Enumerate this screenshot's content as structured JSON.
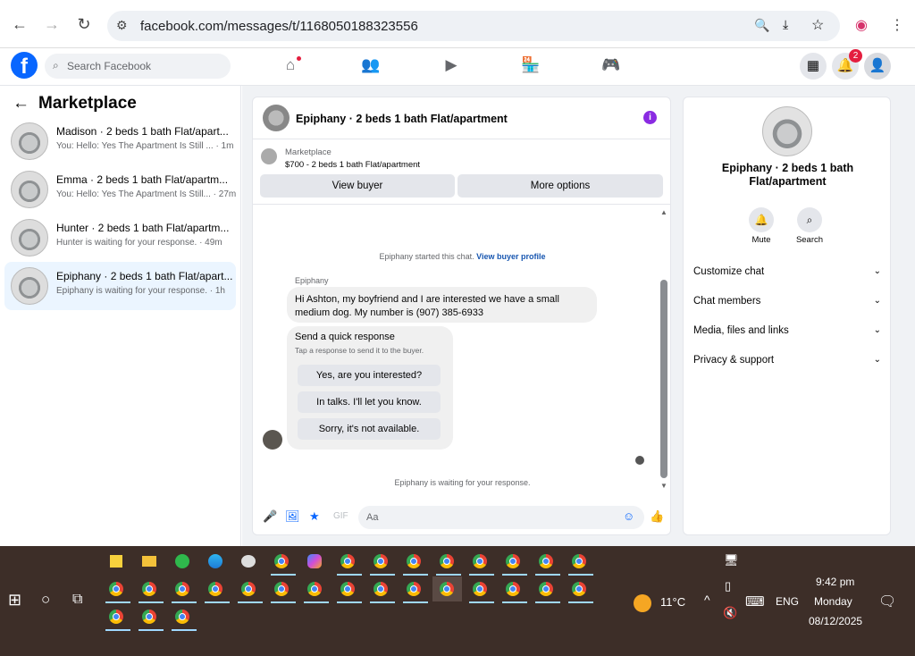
{
  "browser": {
    "url": "facebook.com/messages/t/1168050188323556",
    "back_icon": "arrow-left-icon",
    "forward_icon": "arrow-right-icon",
    "reload_icon": "reload-icon"
  },
  "fb": {
    "search_placeholder": "Search Facebook",
    "notification_count": "2"
  },
  "sidebar": {
    "title": "Marketplace",
    "conversations": [
      {
        "name": "Madison · 2 beds 1 bath Flat/apart...",
        "preview": "You: Hello: Yes The Apartment Is Still ...",
        "time": "· 1m"
      },
      {
        "name": "Emma · 2 beds 1 bath Flat/apartm...",
        "preview": "You: Hello: Yes The Apartment Is Still...",
        "time": "· 27m"
      },
      {
        "name": "Hunter · 2 beds 1 bath Flat/apartm...",
        "preview": "Hunter is waiting for your response.",
        "time": "· 49m"
      },
      {
        "name": "Epiphany · 2 beds 1 bath Flat/apart...",
        "preview": "Epiphany is waiting for your response.",
        "time": "· 1h"
      }
    ]
  },
  "chat": {
    "title": "Epiphany · 2 beds 1 bath Flat/apartment",
    "marketplace_label": "Marketplace",
    "listing": "$700 - 2 beds 1 bath Flat/apartment",
    "view_buyer": "View buyer",
    "more_options": "More options",
    "started_text": "Epiphany started this chat.",
    "view_profile": "View buyer profile",
    "sender": "Epiphany",
    "message": "Hi Ashton, my boyfriend and I are interested we have a small medium dog. My number is (907) 385-6933",
    "quick_title": "Send a quick response",
    "quick_sub": "Tap a response to send it to the buyer.",
    "quick_options": [
      "Yes, are you interested?",
      "In talks. I'll let you know.",
      "Sorry, it's not available."
    ],
    "waiting": "Epiphany is waiting for your response.",
    "input_placeholder": "Aa"
  },
  "info_panel": {
    "name": "Epiphany · 2 beds 1 bath Flat/apartment",
    "mute": "Mute",
    "search": "Search",
    "sections": [
      "Customize chat",
      "Chat members",
      "Media, files and links",
      "Privacy & support"
    ]
  },
  "taskbar": {
    "weather": "11°C",
    "lang": "ENG",
    "time": "9:42 pm",
    "day": "Monday",
    "date": "08/12/2025"
  }
}
